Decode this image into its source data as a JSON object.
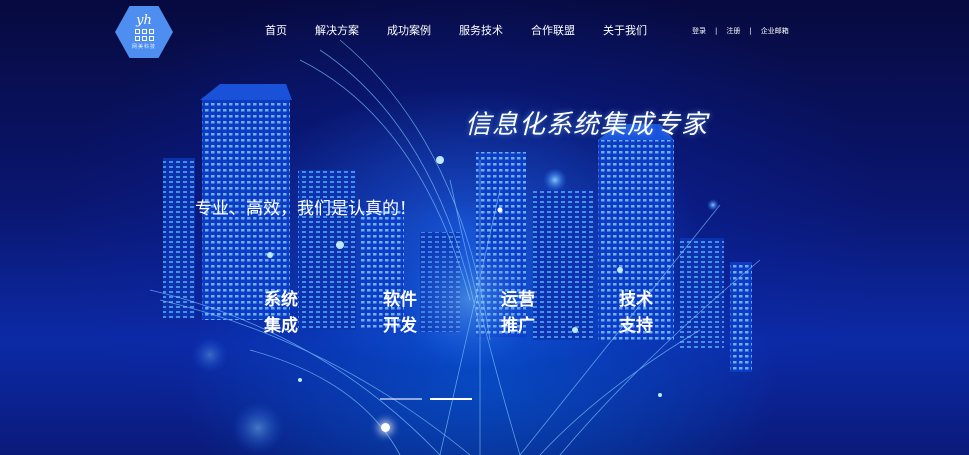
{
  "brand": {
    "mark": "yh",
    "sub": "网美科技"
  },
  "nav": [
    {
      "label": "首页"
    },
    {
      "label": "解决方案"
    },
    {
      "label": "成功案例"
    },
    {
      "label": "服务技术"
    },
    {
      "label": "合作联盟"
    },
    {
      "label": "关于我们"
    }
  ],
  "utility": {
    "login": "登录",
    "register": "注册",
    "mail": "企业邮箱",
    "separator": "|"
  },
  "hero": {
    "slogan": "信息化系统集成专家",
    "tagline": "专业、高效，我们是认真的！",
    "services": [
      {
        "line1": "系统",
        "line2": "集成"
      },
      {
        "line1": "软件",
        "line2": "开发"
      },
      {
        "line1": "运营",
        "line2": "推广"
      },
      {
        "line1": "技术",
        "line2": "支持"
      }
    ]
  },
  "carousel": {
    "slides": 2,
    "active_index": 1
  },
  "colors": {
    "background": "#05083a",
    "glow": "#1e6eff",
    "logo": "#4d8ef0"
  }
}
